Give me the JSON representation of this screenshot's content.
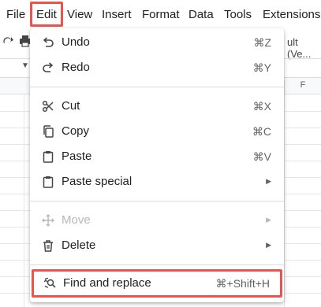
{
  "menubar": {
    "items": [
      {
        "label": "File"
      },
      {
        "label": "Edit"
      },
      {
        "label": "View"
      },
      {
        "label": "Insert"
      },
      {
        "label": "Format"
      },
      {
        "label": "Data"
      },
      {
        "label": "Tools"
      },
      {
        "label": "Extensions"
      }
    ]
  },
  "toolbar": {
    "font_text": "ult (Ve..."
  },
  "sheet": {
    "column_f": "F"
  },
  "edit_menu": {
    "undo": {
      "label": "Undo",
      "shortcut": "⌘Z"
    },
    "redo": {
      "label": "Redo",
      "shortcut": "⌘Y"
    },
    "cut": {
      "label": "Cut",
      "shortcut": "⌘X"
    },
    "copy": {
      "label": "Copy",
      "shortcut": "⌘C"
    },
    "paste": {
      "label": "Paste",
      "shortcut": "⌘V"
    },
    "paste_special": {
      "label": "Paste special"
    },
    "move": {
      "label": "Move"
    },
    "delete": {
      "label": "Delete"
    },
    "find_replace": {
      "label": "Find and replace",
      "shortcut": "⌘+Shift+H"
    }
  },
  "colors": {
    "highlight_border": "#e8554d",
    "disabled_text": "#b8b8b8"
  }
}
